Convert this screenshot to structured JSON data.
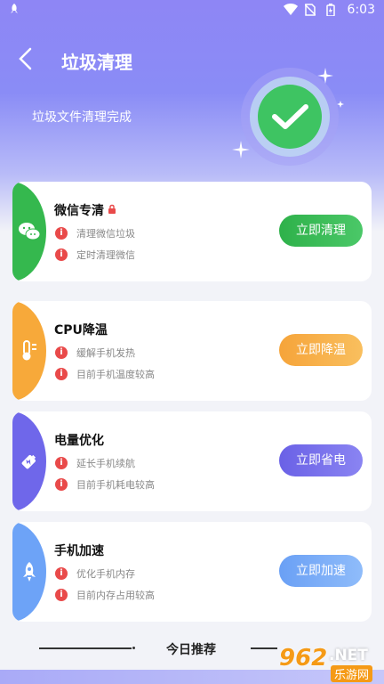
{
  "status_bar": {
    "time": "6:03"
  },
  "header": {
    "title": "垃圾清理",
    "subtitle": "垃圾文件清理完成"
  },
  "cards": [
    {
      "name": "微信专清",
      "lines": [
        "清理微信垃圾",
        "定时清理微信"
      ],
      "button": "立即清理",
      "color": "#35b84e",
      "icon": "wechat-icon",
      "locked": true
    },
    {
      "name": "CPU降温",
      "lines": [
        "缓解手机发热",
        "目前手机温度较高"
      ],
      "button": "立即降温",
      "color": "#f7a93a",
      "icon": "thermometer-icon"
    },
    {
      "name": "电量优化",
      "lines": [
        "延长手机续航",
        "目前手机耗电较高"
      ],
      "button": "立即省电",
      "color": "#6f67ea",
      "icon": "battery-icon"
    },
    {
      "name": "手机加速",
      "lines": [
        "优化手机内存",
        "目前内存占用较高"
      ],
      "button": "立即加速",
      "color": "#6da3f7",
      "icon": "rocket-icon"
    }
  ],
  "footer": {
    "label": "今日推荐"
  },
  "watermark": {
    "number": "962",
    "net": ".NET",
    "site": "乐游网"
  }
}
